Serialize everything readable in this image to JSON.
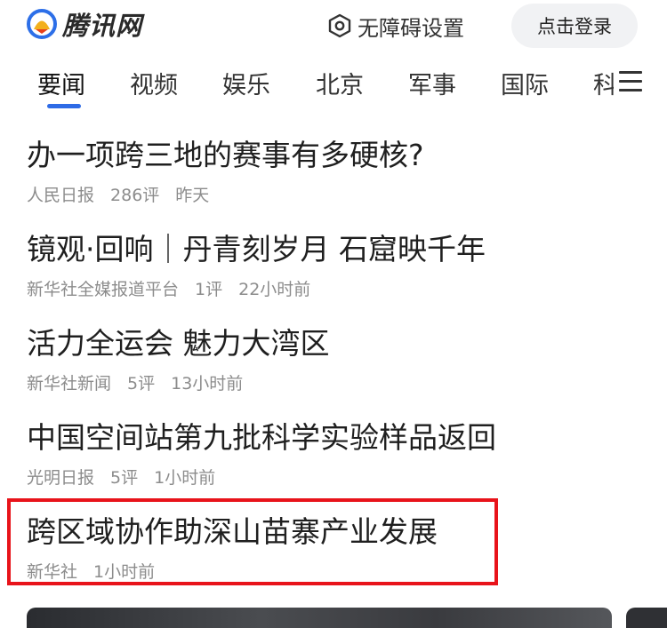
{
  "header": {
    "logo_text": "腾讯网",
    "accessibility_label": "无障碍设置",
    "login_label": "点击登录"
  },
  "nav": {
    "tabs": [
      "要闻",
      "视频",
      "娱乐",
      "北京",
      "军事",
      "国际",
      "科"
    ]
  },
  "news": [
    {
      "title": "办一项跨三地的赛事有多硬核?",
      "meta": [
        "人民日报",
        "286评",
        "昨天"
      ]
    },
    {
      "title": "镜观·回响｜丹青刻岁月 石窟映千年",
      "meta": [
        "新华社全媒报道平台",
        "1评",
        "22小时前"
      ]
    },
    {
      "title": "活力全运会 魅力大湾区",
      "meta": [
        "新华社新闻",
        "5评",
        "13小时前"
      ]
    },
    {
      "title": "中国空间站第九批科学实验样品返回",
      "meta": [
        "光明日报",
        "5评",
        "1小时前"
      ]
    },
    {
      "title": "跨区域协作助深山苗寨产业发展",
      "meta": [
        "新华社",
        "1小时前"
      ]
    }
  ],
  "colors": {
    "accent": "#2e6be6",
    "highlight_border": "#e8131a",
    "meta_text": "#8c8c8c"
  }
}
